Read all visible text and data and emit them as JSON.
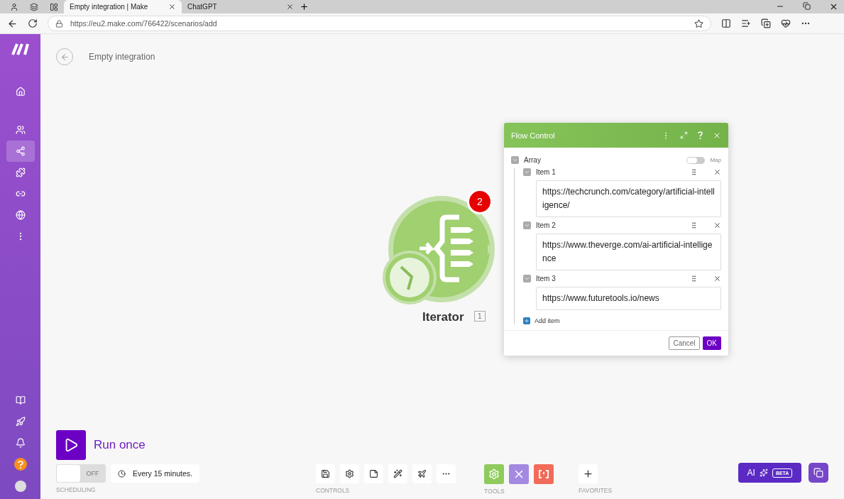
{
  "browser": {
    "tabs": [
      {
        "title": "Empty integration | Make",
        "selected": true
      },
      {
        "title": "ChatGPT",
        "selected": false
      }
    ],
    "url": "https://eu2.make.com/766422/scenarios/add"
  },
  "sidebar": {
    "items": [
      {
        "selected": false
      },
      {
        "selected": false
      },
      {
        "selected": true
      },
      {
        "selected": false
      },
      {
        "selected": false
      },
      {
        "selected": false
      },
      {
        "selected": false
      }
    ]
  },
  "scenario_title": "Empty integration",
  "module": {
    "name": "Iterator",
    "badge": "2",
    "number": "1"
  },
  "dialog": {
    "title": "Flow Control",
    "array_label": "Array",
    "map_label": "Map",
    "map_on": false,
    "items": [
      {
        "label": "Item 1",
        "value": "https://techcrunch.com/category/artificial-intelligence/",
        "expanded": true
      },
      {
        "label": "Item 2",
        "value": "https://www.theverge.com/ai-artificial-intelligence",
        "expanded": true
      },
      {
        "label": "Item 3",
        "value": "https://www.futuretools.io/news",
        "expanded": true
      }
    ],
    "add_item": "Add item",
    "cancel": "Cancel",
    "ok": "OK"
  },
  "run_once": "Run once",
  "scheduling": {
    "on": false,
    "toggle_label": "OFF",
    "schedule": "Every 15 minutes.",
    "section": "SCHEDULING"
  },
  "controls_section": "CONTROLS",
  "tools_section": "TOOLS",
  "favorites_section": "FAVORITES",
  "ai_button": {
    "label": "AI",
    "badge": "BETA"
  }
}
